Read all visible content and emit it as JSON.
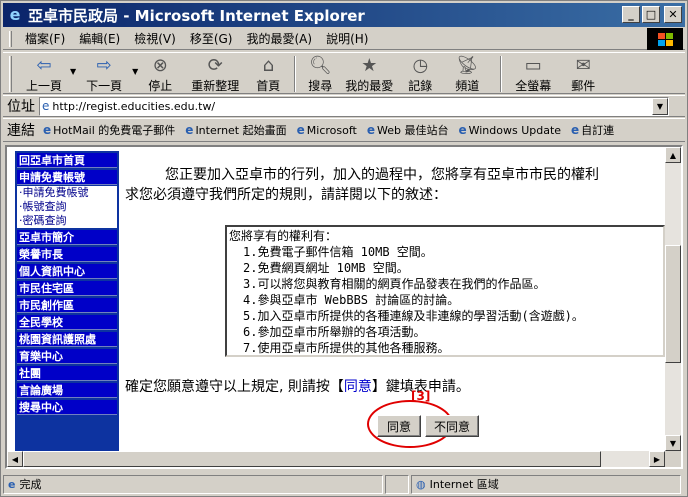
{
  "window": {
    "title": "亞卓市民政局 - Microsoft Internet Explorer"
  },
  "menu": [
    "檔案(F)",
    "編輯(E)",
    "檢視(V)",
    "移至(G)",
    "我的最愛(A)",
    "說明(H)"
  ],
  "toolbar": {
    "back": "上一頁",
    "forward": "下一頁",
    "stop": "停止",
    "refresh": "重新整理",
    "home": "首頁",
    "search": "搜尋",
    "favorites": "我的最愛",
    "history": "記錄",
    "channels": "頻道",
    "fullscreen": "全螢幕",
    "mail": "郵件"
  },
  "address": {
    "label": "位址",
    "url": "http://regist.educities.edu.tw/"
  },
  "links": {
    "label": "連結",
    "items": [
      "HotMail 的免費電子郵件",
      "Internet 起始畫面",
      "Microsoft",
      "Web 最佳站台",
      "Windows Update",
      "自訂連"
    ]
  },
  "sidebar": {
    "home": "回亞卓市首頁",
    "apply": "申請免費帳號",
    "sub_apply": "‧申請免費帳號",
    "sub_query": "‧帳號查詢",
    "sub_password": "‧密碼查詢",
    "intro": "亞卓市簡介",
    "mayor": "榮譽市長",
    "info": "個人資訊中心",
    "housing": "市民住宅區",
    "creation": "市民創作區",
    "school": "全民學校",
    "taoyuan": "桃園資訊護照處",
    "fun": "育樂中心",
    "community": "社團",
    "forum": "言論廣場",
    "search": "搜尋中心"
  },
  "main": {
    "intro_line1": "您正要加入亞卓市的行列，加入的過程中，您將享有亞卓市市民的權利",
    "intro_line2": "求您必須遵守我們所定的規則，請詳閱以下的敘述：",
    "rights_title": "您將享有的權利有：",
    "rights": [
      "1.免費電子郵件信箱 10MB 空間。",
      "2.免費網頁網址 10MB 空間。",
      "3.可以將您與教育相關的網頁作品發表在我們的作品區。",
      "4.參與亞卓市 WebBBS 討論區的討論。",
      "5.加入亞卓市所提供的各種連線及非連線的學習活動(含遊戲)。",
      "6.參加亞卓市所舉辦的各項活動。",
      "7.使用亞卓市所提供的其他各種服務。"
    ],
    "confirm_before": "確定您願意遵守以上規定, 則請按【",
    "confirm_link": "同意",
    "confirm_after": "】鍵填表申請。",
    "agree_button": "同意",
    "disagree_button": "不同意",
    "annotation": "[3]"
  },
  "status": {
    "text": "完成",
    "zone": "Internet 區域"
  }
}
